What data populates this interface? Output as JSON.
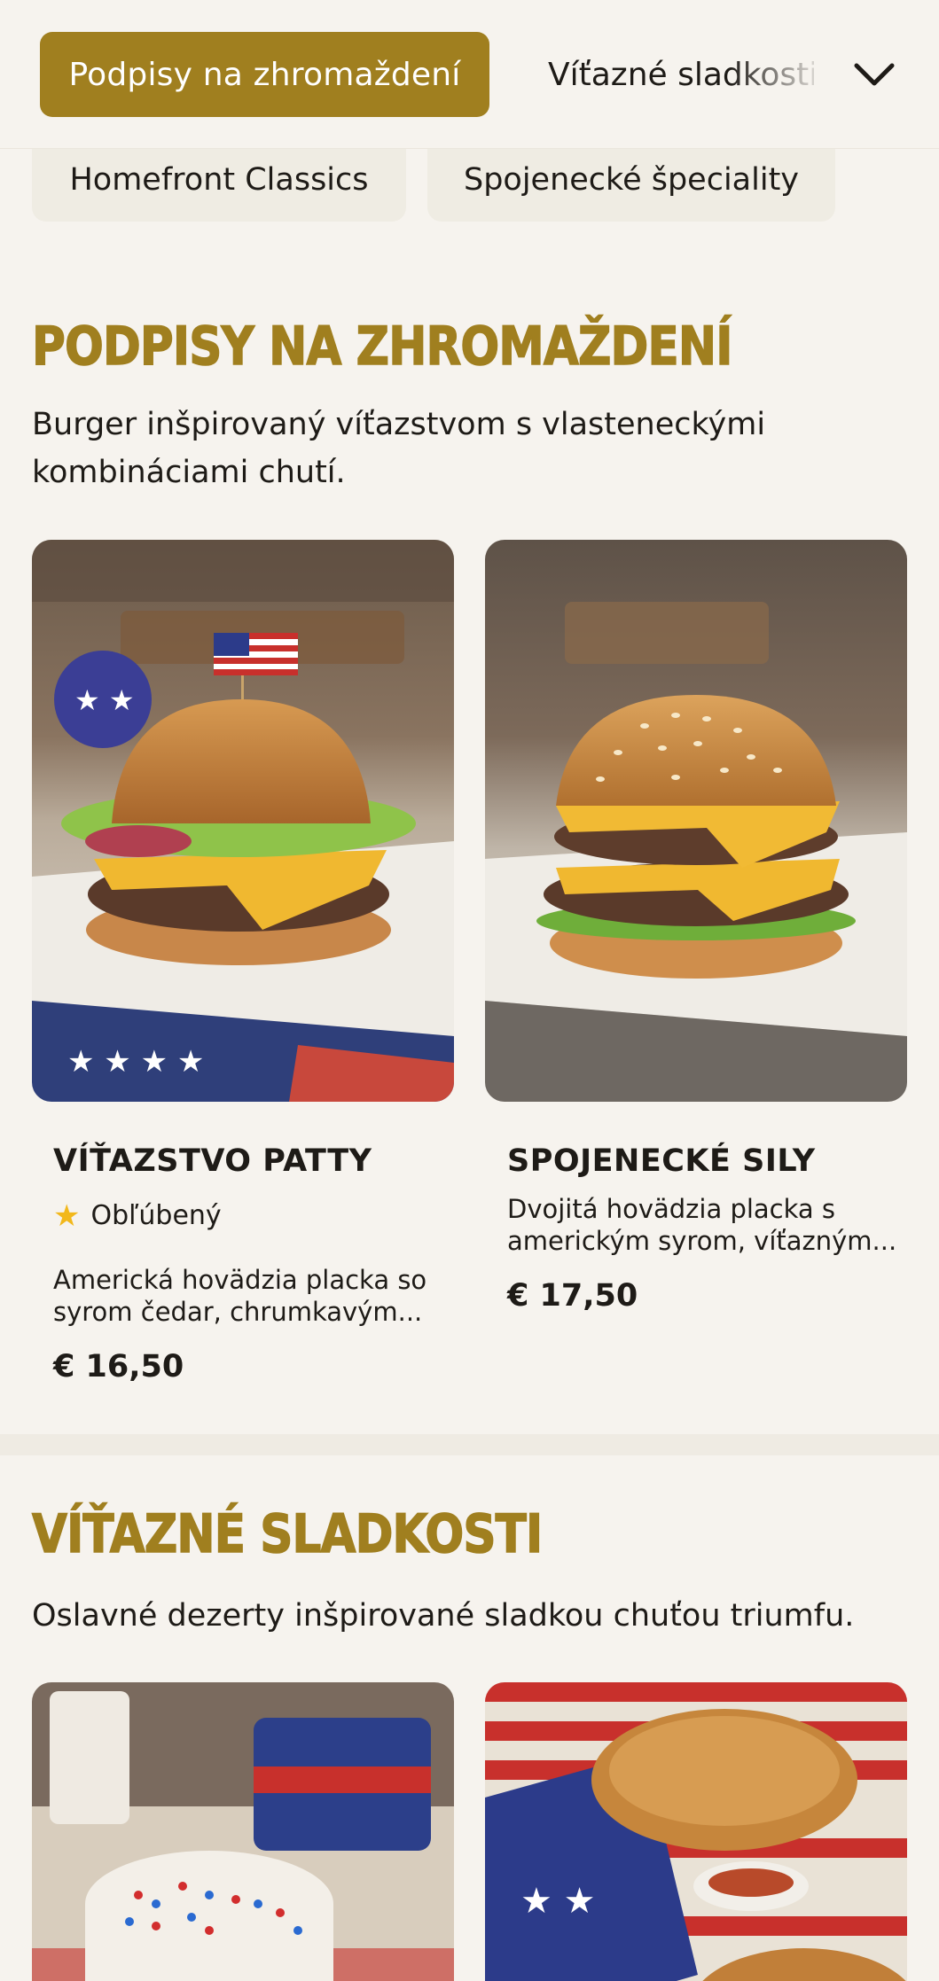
{
  "nav": {
    "active_tab": "Podpisy na zhromaždení",
    "next_tab": "Víťazné sladkosti",
    "sub_tabs": [
      "Homefront Classics",
      "Spojenecké špeciality"
    ],
    "expand_icon": "chevron-down-icon"
  },
  "sections": [
    {
      "title": "PODPISY NA ZHROMAŽDENÍ",
      "description": "Burger inšpirovaný víťazstvom s vlasteneckými kombináciami chutí.",
      "items": [
        {
          "name": "VÍŤAZSTVO PATTY",
          "badge": "Obľúbený",
          "badge_icon": "star-icon",
          "description": "Americká hovädzia placka so syrom čedar, chrumkavým...",
          "price": "€ 16,50"
        },
        {
          "name": "SPOJENECKÉ SILY",
          "description": "Dvojitá hovädzia placka s americkým syrom, víťazným...",
          "price": "€ 17,50"
        }
      ]
    },
    {
      "title": "VÍŤAZNÉ SLADKOSTI",
      "description": "Oslavné dezerty inšpirované sladkou chuťou triumfu."
    }
  ],
  "colors": {
    "accent": "#a07f1f",
    "background": "#f6f3ee",
    "chip": "#efece3",
    "star": "#f2b81b"
  }
}
